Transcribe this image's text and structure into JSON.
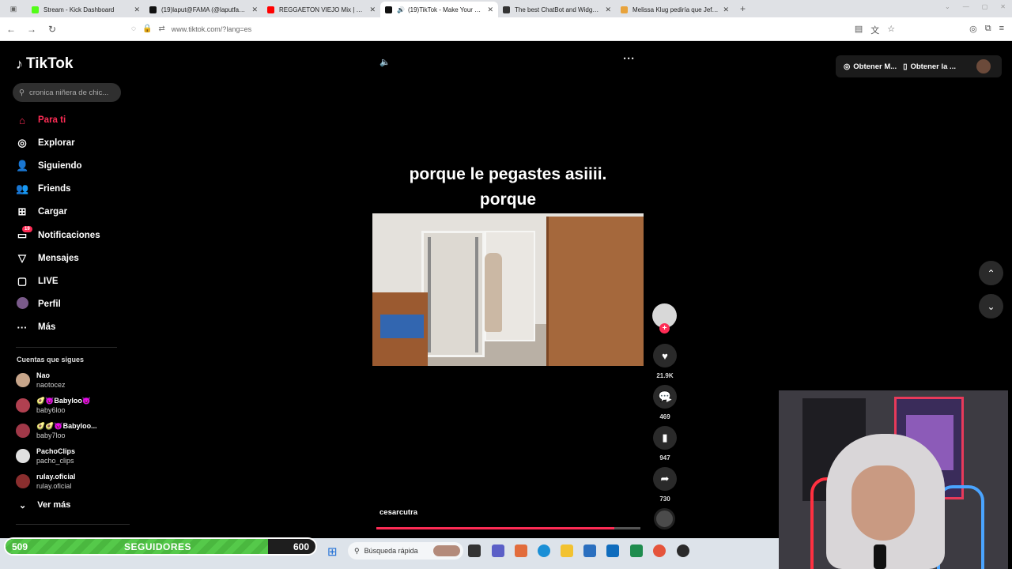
{
  "browser": {
    "tabs": [
      {
        "label": "Stream - Kick Dashboard",
        "color": "#53fc18"
      },
      {
        "label": "(19)laput@FAMA (@laputfama_",
        "color": "#111111"
      },
      {
        "label": "REGGAETON VIEJO Mix | Old Sc",
        "color": "#ff0000"
      },
      {
        "label": "(19)TikTok - Make Your Day",
        "color": "#111111"
      },
      {
        "label": "The best ChatBot and Widgets f",
        "color": "#333333"
      },
      {
        "label": "Melissa Klug pediría que Jeffers",
        "color": "#e8a33c"
      }
    ],
    "url": "www.tiktok.com/?lang=es"
  },
  "tiktok": {
    "brand": "TikTok",
    "search_placeholder": "cronica niñera de chic...",
    "nav": [
      {
        "label": "Para ti",
        "icon": "home-icon"
      },
      {
        "label": "Explorar",
        "icon": "compass-icon"
      },
      {
        "label": "Siguiendo",
        "icon": "following-icon"
      },
      {
        "label": "Friends",
        "icon": "friends-icon"
      },
      {
        "label": "Cargar",
        "icon": "upload-icon"
      },
      {
        "label": "Notificaciones",
        "icon": "inbox-icon",
        "badge": "19"
      },
      {
        "label": "Mensajes",
        "icon": "message-icon"
      },
      {
        "label": "LIVE",
        "icon": "live-icon"
      },
      {
        "label": "Perfil",
        "icon": "profile-avatar"
      },
      {
        "label": "Más",
        "icon": "more-icon"
      }
    ],
    "following_title": "Cuentas que sigues",
    "following": [
      {
        "name": "Nao",
        "handle": "naotocez"
      },
      {
        "name": "🥑😈Babyloo😈",
        "handle": "baby6loo"
      },
      {
        "name": "🥑🥑😈Babyloo...",
        "handle": "baby7loo"
      },
      {
        "name": "PachoClips",
        "handle": "pacho_clips"
      },
      {
        "name": "rulay.oficial",
        "handle": "rulay.oficial"
      }
    ],
    "see_more": "Ver más",
    "top_buttons": {
      "coins": "Obtener M...",
      "app": "Obtener la ..."
    },
    "caption_line1": "porque le pegastes asiiii.",
    "caption_line2": "porque",
    "author": "cesarcutra",
    "likes": "21.9K",
    "comments": "469",
    "saves": "947",
    "shares": "730",
    "video_progress": 0.9
  },
  "stream": {
    "followers_current": "509",
    "followers_label": "SEGUIDORES",
    "followers_goal": "600",
    "followers_progress": 0.848,
    "taskbar_search": "Búsqueda rápida"
  }
}
